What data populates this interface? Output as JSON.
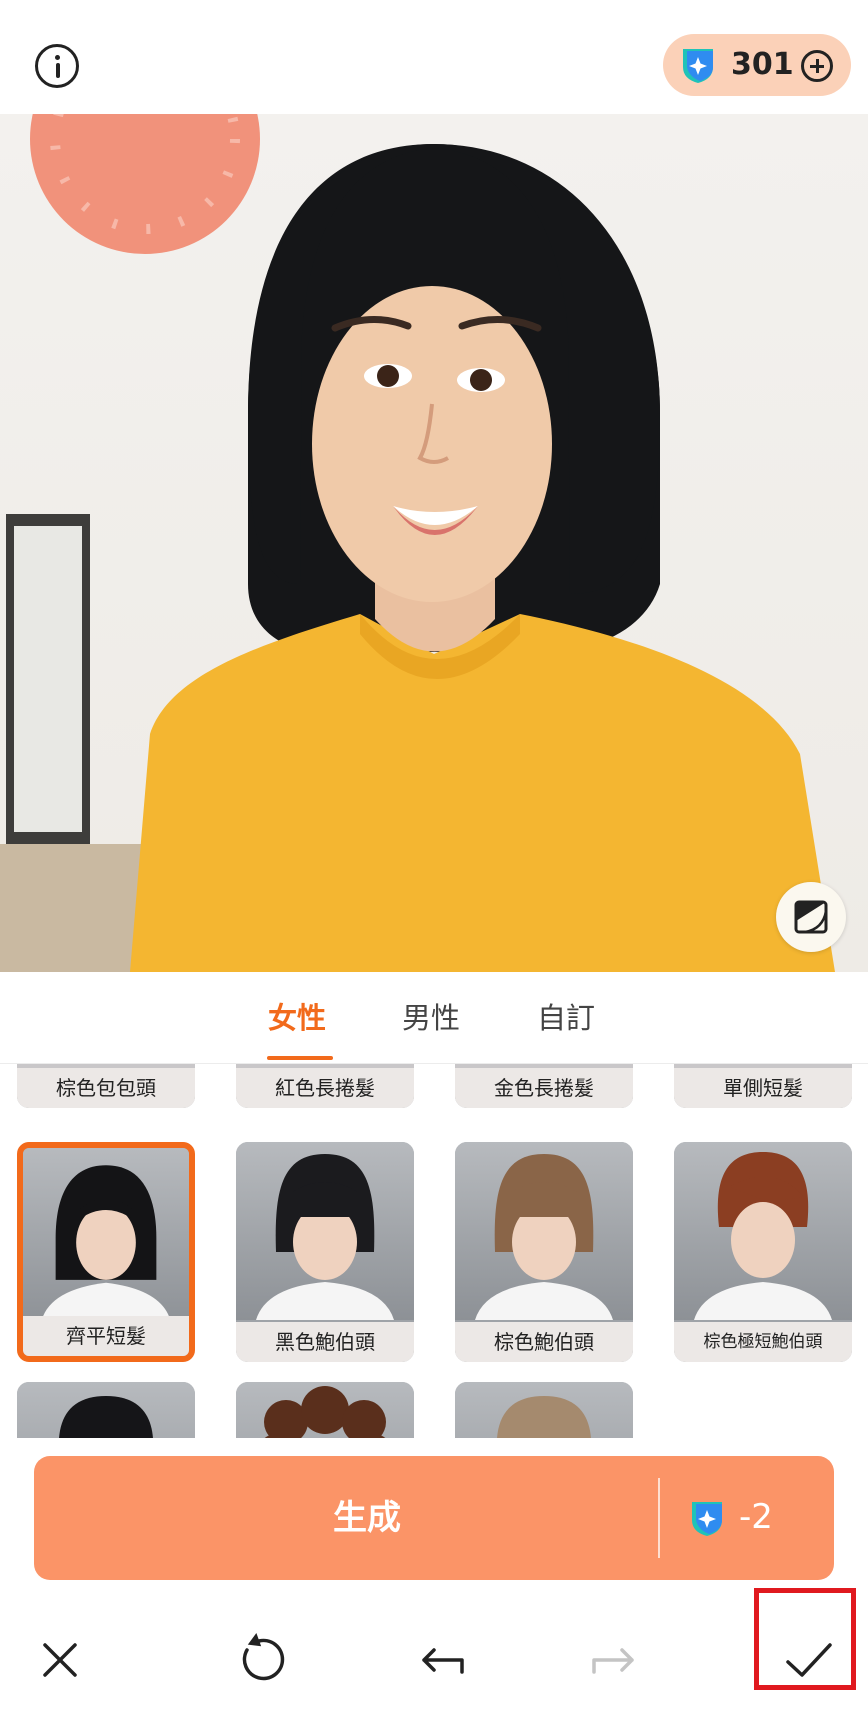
{
  "header": {
    "credits": "301",
    "info_icon": "info-icon",
    "credits_icon": "gem-icon",
    "add_icon": "plus-circle-icon"
  },
  "photo": {
    "compare_icon": "compare-icon"
  },
  "tabs": [
    {
      "label": "女性",
      "active": true
    },
    {
      "label": "男性",
      "active": false
    },
    {
      "label": "自訂",
      "active": false
    }
  ],
  "styles": {
    "row1": [
      "棕色包包頭",
      "紅色長捲髮",
      "金色長捲髮",
      "單側短髮"
    ],
    "row2": [
      "齊平短髮",
      "黑色鮑伯頭",
      "棕色鮑伯頭",
      "棕色極短鮑伯頭"
    ],
    "selected": "齊平短髮"
  },
  "generate": {
    "label": "生成",
    "cost": "-2"
  },
  "toolbar": {
    "close_icon": "close-icon",
    "reset_icon": "reset-icon",
    "undo_icon": "undo-icon",
    "redo_icon": "redo-icon",
    "confirm_icon": "check-icon"
  },
  "colors": {
    "accent": "#f26a1b",
    "generate_button": "#fb9467",
    "credits_pill": "#fbd1b8",
    "highlight": "#e0191f"
  }
}
